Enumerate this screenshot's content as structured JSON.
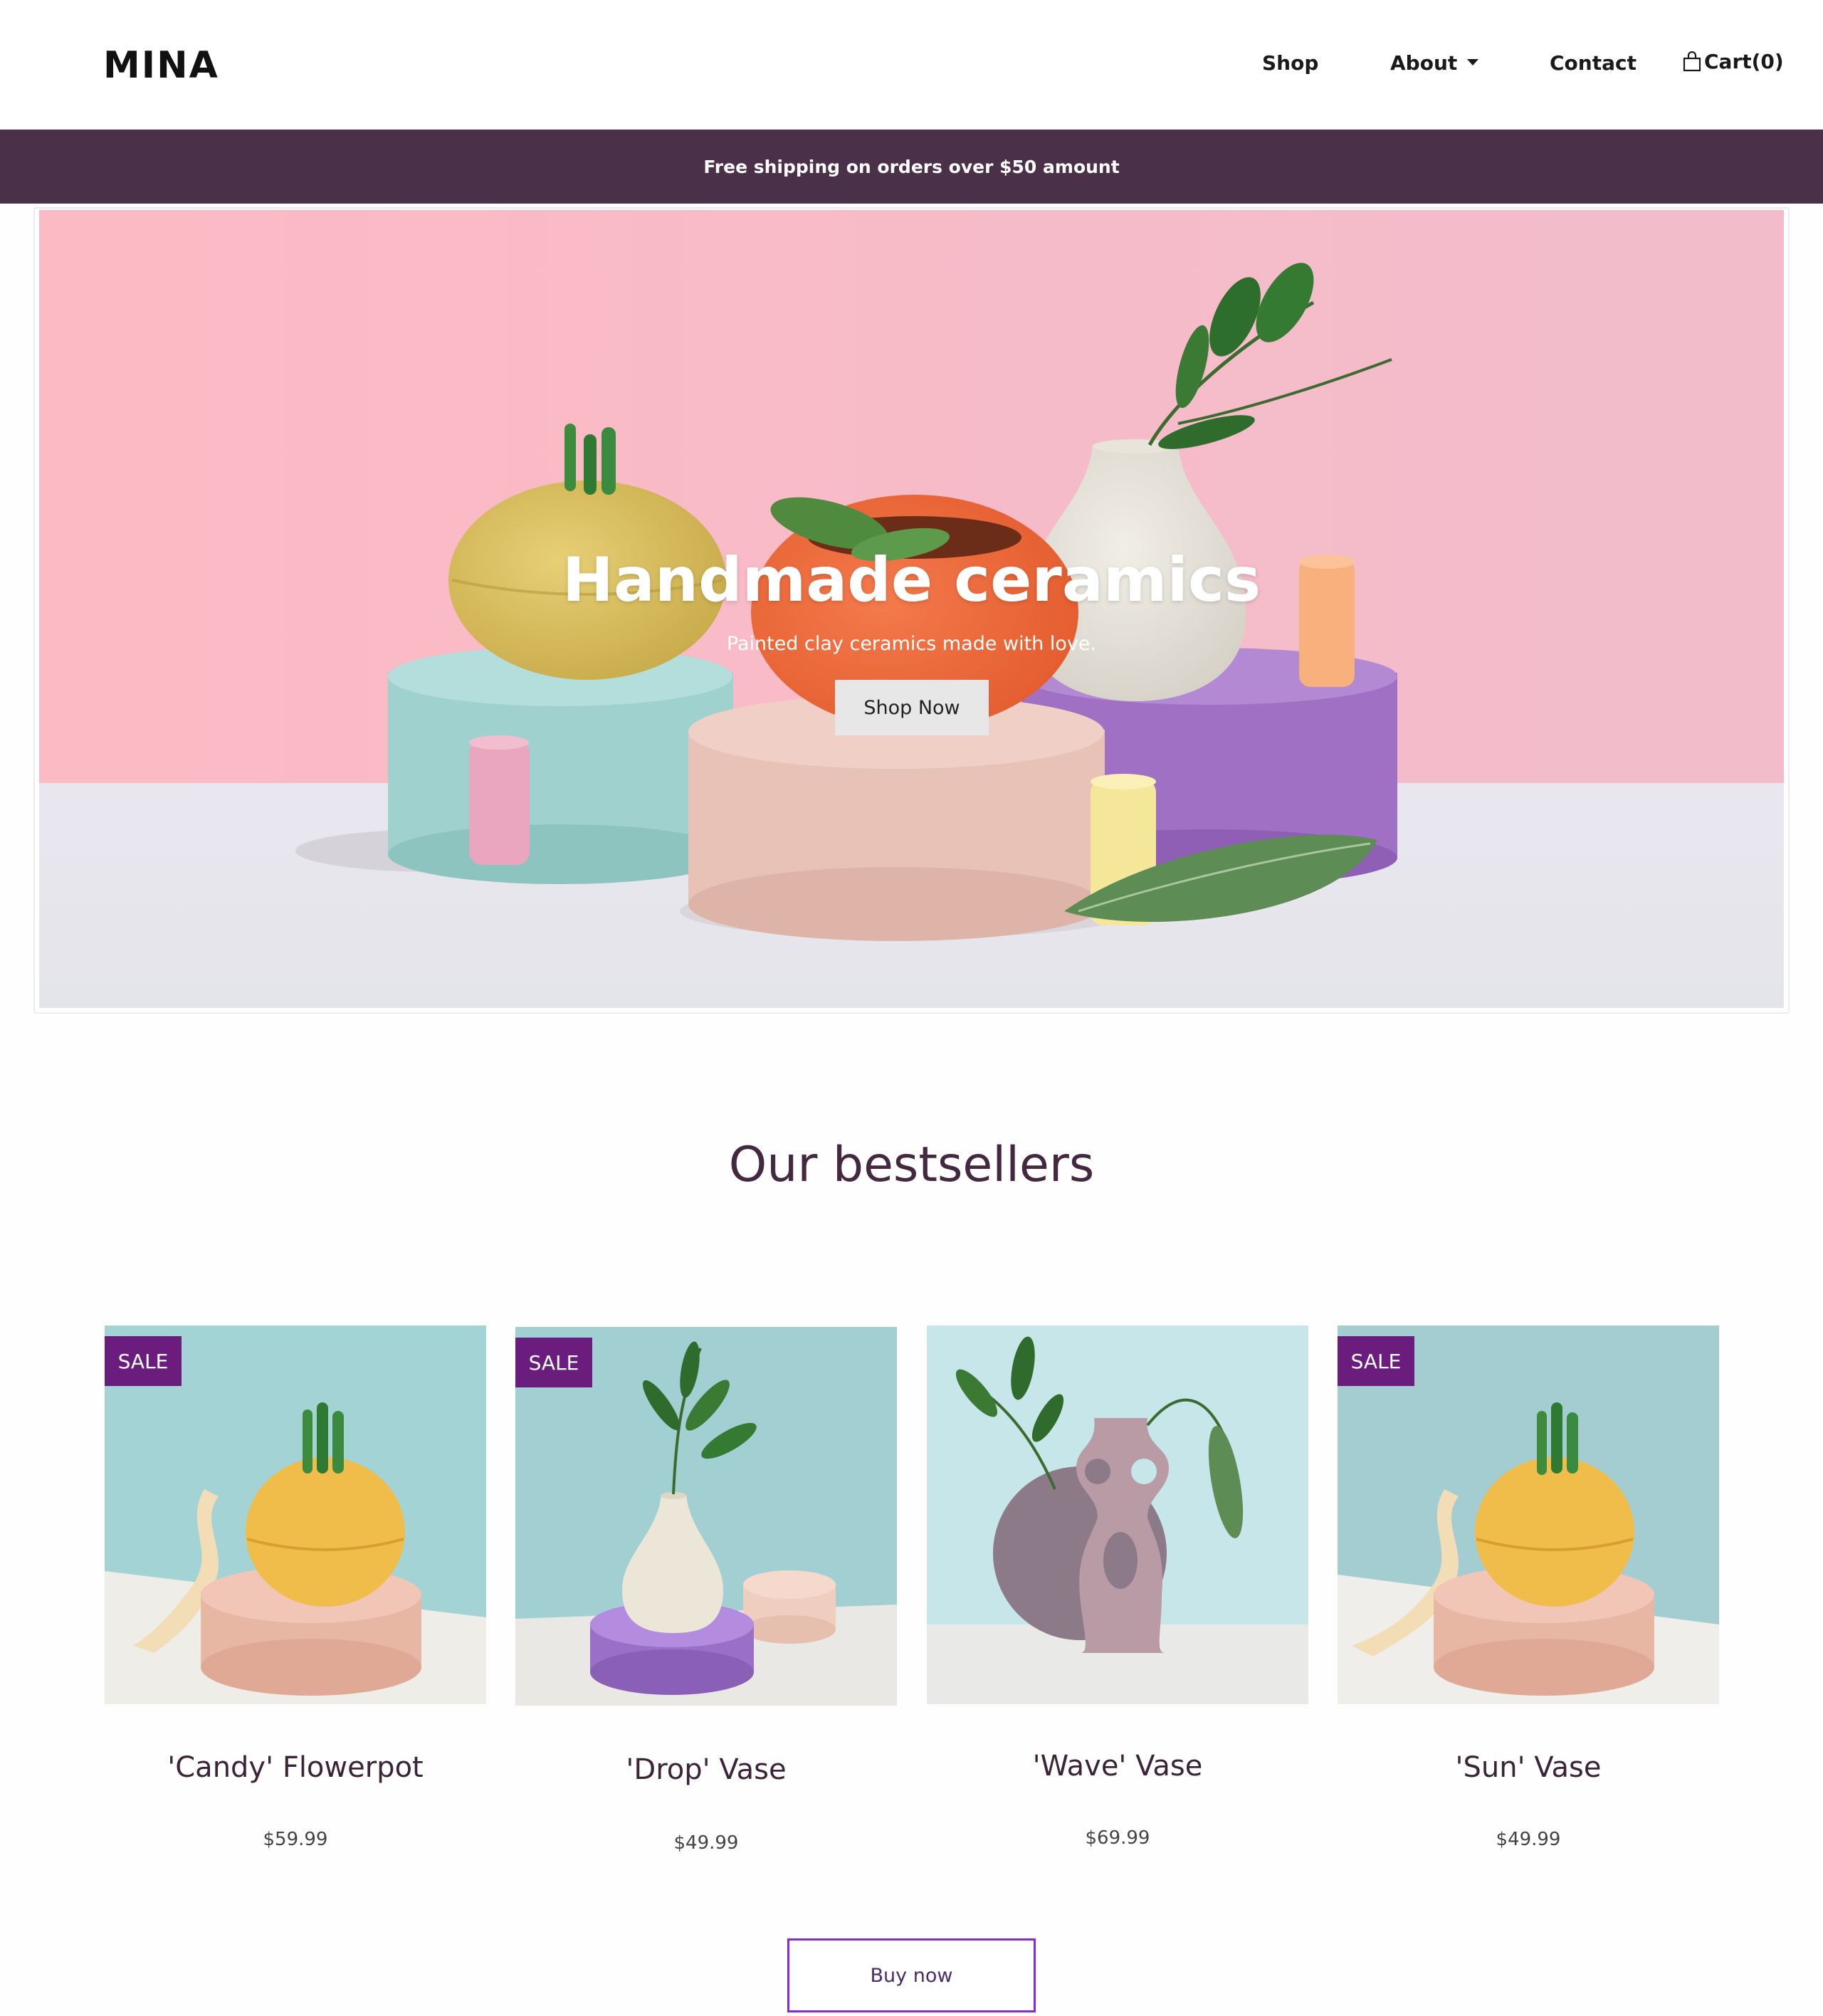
{
  "nav": {
    "logo": "MINA",
    "shop": "Shop",
    "about": "About",
    "contact": "Contact",
    "cart": "Cart(0)"
  },
  "banner": {
    "text": "Free shipping on orders over $50 amount"
  },
  "hero": {
    "title": "Handmade ceramics",
    "subtitle": "Painted clay ceramics made with love.",
    "button": "Shop Now"
  },
  "bestsellers": {
    "title": "Our bestsellers",
    "products": [
      {
        "name": "'Candy' Flowerpot",
        "price": "$59.99",
        "badge": "SALE"
      },
      {
        "name": "'Drop' Vase",
        "price": "$49.99",
        "badge": "SALE"
      },
      {
        "name": "'Wave' Vase",
        "price": "$69.99",
        "badge": ""
      },
      {
        "name": "'Sun' Vase",
        "price": "$49.99",
        "badge": "SALE"
      }
    ],
    "buy_button": "Buy now"
  },
  "colors": {
    "banner": "#4a3048",
    "accent_purple": "#6b1d7d",
    "heading": "#43283f",
    "hero_wall": "#f6bcc7"
  }
}
